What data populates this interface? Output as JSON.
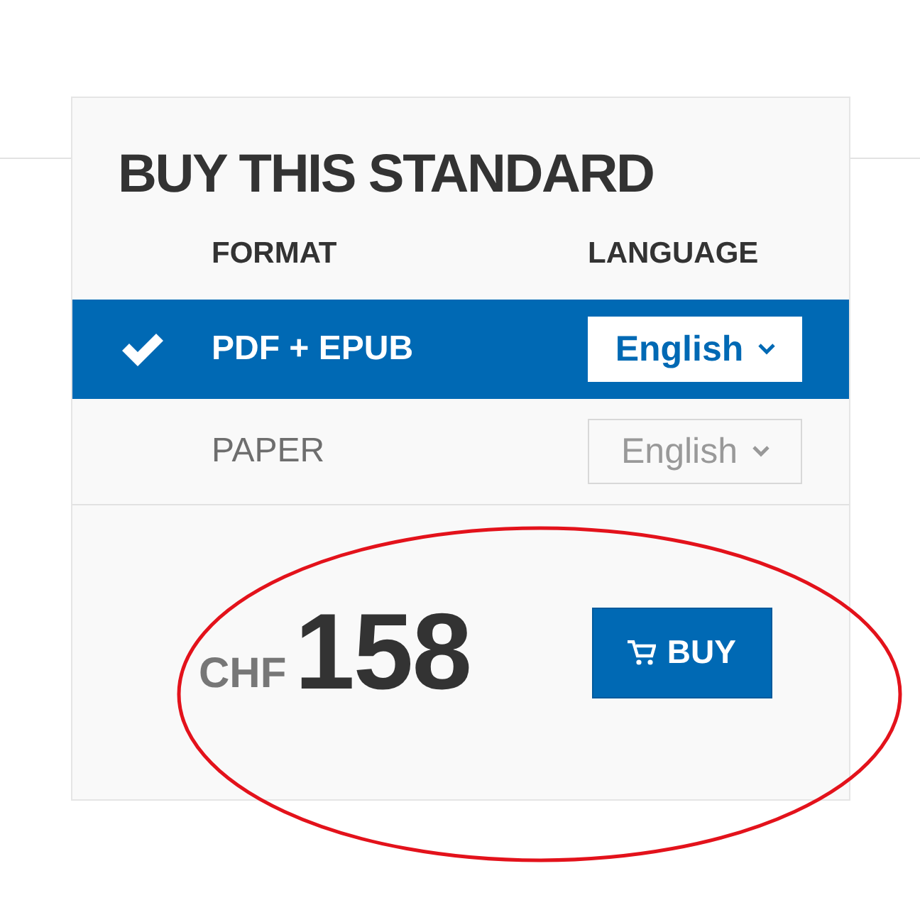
{
  "title": "BUY THIS STANDARD",
  "columns": [
    "FORMAT",
    "LANGUAGE"
  ],
  "options": [
    {
      "format": "PDF + EPUB",
      "language": "English",
      "selected": true
    },
    {
      "format": "PAPER",
      "language": "English",
      "selected": false
    }
  ],
  "price": {
    "currency": "CHF",
    "amount": "158"
  },
  "buy_button": {
    "label": "BUY"
  }
}
